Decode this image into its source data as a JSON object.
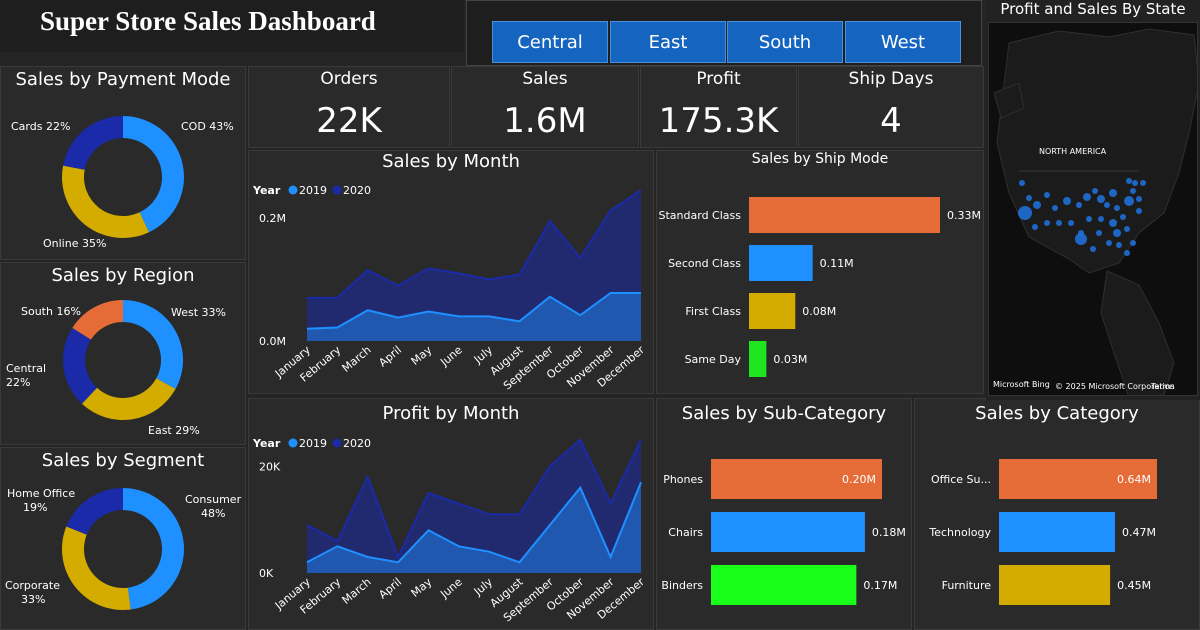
{
  "title": "Super Store Sales Dashboard",
  "regions": [
    "Central",
    "East",
    "South",
    "West"
  ],
  "kpis": [
    {
      "label": "Orders",
      "value": "22K"
    },
    {
      "label": "Sales",
      "value": "1.6M"
    },
    {
      "label": "Profit",
      "value": "175.3K"
    },
    {
      "label": "Ship Days",
      "value": "4"
    }
  ],
  "map": {
    "title": "Profit and Sales By State",
    "label": "NORTH AMERICA",
    "attribution_logo": "Microsoft Bing",
    "attribution": "© 2025 Microsoft Corporation",
    "terms": "Terms",
    "dot_color": "#1f6fd6"
  },
  "colors": {
    "blue": "#1e90ff",
    "navy": "#1a2aa8",
    "gold": "#d4ac00",
    "orange": "#e66c37",
    "green": "#1aff1a",
    "lime": "#1fe51f"
  },
  "chart_data": [
    {
      "id": "payment",
      "type": "pie",
      "title": "Sales by Payment Mode",
      "slices": [
        {
          "label": "COD 43%",
          "value": 43,
          "color": "#1e90ff"
        },
        {
          "label": "Online 35%",
          "value": 35,
          "color": "#d4ac00"
        },
        {
          "label": "Cards 22%",
          "value": 22,
          "color": "#1a2aa8"
        }
      ]
    },
    {
      "id": "region",
      "type": "pie",
      "title": "Sales by Region",
      "slices": [
        {
          "label": "West 33%",
          "value": 33,
          "color": "#1e90ff"
        },
        {
          "label": "East 29%",
          "value": 29,
          "color": "#d4ac00"
        },
        {
          "label": "Central 22%",
          "value": 22,
          "color": "#1a2aa8"
        },
        {
          "label": "South 16%",
          "value": 16,
          "color": "#e66c37"
        }
      ]
    },
    {
      "id": "segment",
      "type": "pie",
      "title": "Sales by Segment",
      "slices": [
        {
          "label": "Consumer 48%",
          "value": 48,
          "color": "#1e90ff"
        },
        {
          "label": "Corporate 33%",
          "value": 33,
          "color": "#d4ac00"
        },
        {
          "label": "Home Office 19%",
          "value": 19,
          "color": "#1a2aa8"
        }
      ]
    },
    {
      "id": "salesmonth",
      "type": "area",
      "title": "Sales by Month",
      "legend_title": "Year",
      "categories": [
        "January",
        "February",
        "March",
        "April",
        "May",
        "June",
        "July",
        "August",
        "September",
        "October",
        "November",
        "December"
      ],
      "series": [
        {
          "name": "2019",
          "color": "#1e90ff",
          "values": [
            20000,
            22000,
            50000,
            38000,
            48000,
            40000,
            40000,
            32000,
            72000,
            42000,
            78000,
            78000
          ]
        },
        {
          "name": "2020",
          "color": "#1a2aa8",
          "values": [
            70000,
            70000,
            115000,
            90000,
            118000,
            110000,
            100000,
            108000,
            195000,
            135000,
            212000,
            245000
          ]
        }
      ],
      "yticks": [
        {
          "v": 0,
          "label": "0.0M"
        },
        {
          "v": 200000,
          "label": "0.2M"
        }
      ],
      "ylim": [
        0,
        260000
      ]
    },
    {
      "id": "profitmonth",
      "type": "area",
      "title": "Profit by Month",
      "legend_title": "Year",
      "categories": [
        "January",
        "February",
        "March",
        "April",
        "May",
        "June",
        "July",
        "August",
        "September",
        "October",
        "November",
        "December"
      ],
      "series": [
        {
          "name": "2019",
          "color": "#1e90ff",
          "values": [
            2000,
            5000,
            3000,
            2000,
            8000,
            5000,
            4000,
            2000,
            9000,
            16000,
            3000,
            17000
          ]
        },
        {
          "name": "2020",
          "color": "#1a2aa8",
          "values": [
            9000,
            6000,
            18000,
            3000,
            15000,
            13000,
            11000,
            11000,
            20000,
            25000,
            13000,
            25000
          ]
        }
      ],
      "yticks": [
        {
          "v": 0,
          "label": "0K"
        },
        {
          "v": 20000,
          "label": "20K"
        }
      ],
      "ylim": [
        0,
        27000
      ]
    },
    {
      "id": "shipmode",
      "type": "bar",
      "title": "Sales by Ship Mode",
      "categories": [
        "Standard Class",
        "Second Class",
        "First Class",
        "Same Day"
      ],
      "values": [
        0.33,
        0.11,
        0.08,
        0.03
      ],
      "labels": [
        "0.33M",
        "0.11M",
        "0.08M",
        "0.03M"
      ],
      "colors": [
        "#e66c37",
        "#1e90ff",
        "#d4ac00",
        "#1fe51f"
      ]
    },
    {
      "id": "subcat",
      "type": "bar",
      "title": "Sales by Sub-Category",
      "categories": [
        "Phones",
        "Chairs",
        "Binders"
      ],
      "values": [
        0.2,
        0.18,
        0.17
      ],
      "labels": [
        "0.20M",
        "0.18M",
        "0.17M"
      ],
      "colors": [
        "#e66c37",
        "#1e90ff",
        "#1aff1a"
      ]
    },
    {
      "id": "category",
      "type": "bar",
      "title": "Sales by Category",
      "categories": [
        "Office Su...",
        "Technology",
        "Furniture"
      ],
      "values": [
        0.64,
        0.47,
        0.45
      ],
      "labels": [
        "0.64M",
        "0.47M",
        "0.45M"
      ],
      "colors": [
        "#e66c37",
        "#1e90ff",
        "#d4ac00"
      ]
    }
  ]
}
